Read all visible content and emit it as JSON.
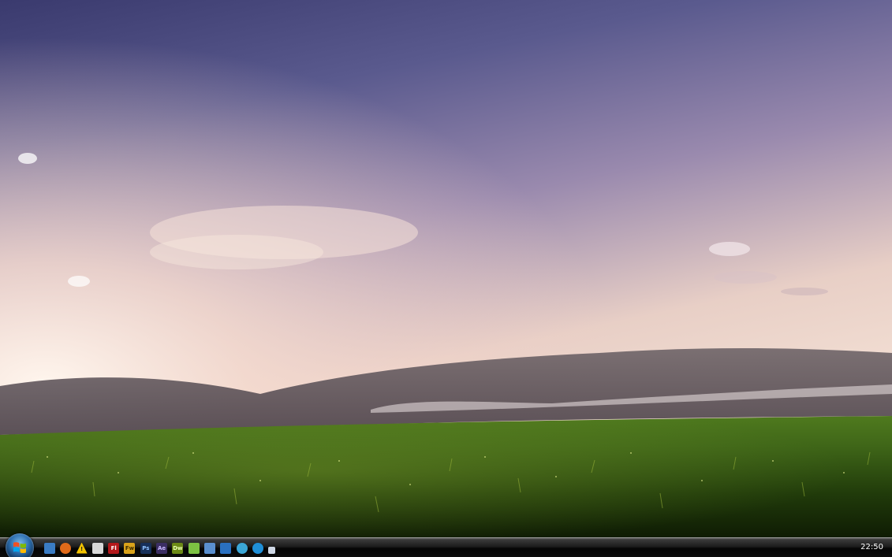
{
  "desktop": {
    "wallpaper": "grass-field-sunset"
  },
  "taskbar": {
    "start_button": "windows-start-orb",
    "quick_launch": [
      {
        "icon": "show-desktop-icon",
        "label": "",
        "bg": "#3a7cc4",
        "fg": "#ffffff"
      },
      {
        "icon": "firefox-icon",
        "label": "",
        "bg": "#e06a1a",
        "fg": "#ffffff"
      },
      {
        "icon": "warning-icon",
        "label": "!",
        "bg": "transparent",
        "fg": "#222222"
      },
      {
        "icon": "lock-icon",
        "label": "",
        "bg": "#d8d8d8",
        "fg": "#333333"
      },
      {
        "icon": "flash-icon",
        "label": "Fl",
        "bg": "#b3181b",
        "fg": "#ffffff"
      },
      {
        "icon": "fireworks-icon",
        "label": "Fw",
        "bg": "#d9a21a",
        "fg": "#3a2a00"
      },
      {
        "icon": "photoshop-icon",
        "label": "Ps",
        "bg": "#17305a",
        "fg": "#8fc2ff"
      },
      {
        "icon": "after-effects-icon",
        "label": "Ae",
        "bg": "#3b2e63",
        "fg": "#c7b7ff"
      },
      {
        "icon": "dreamweaver-icon",
        "label": "Dw",
        "bg": "#6c8a16",
        "fg": "#e9ffb0"
      },
      {
        "icon": "utorrent-icon",
        "label": "",
        "bg": "#7cc142",
        "fg": "#ffffff"
      },
      {
        "icon": "network-icon",
        "label": "",
        "bg": "#5a8fcf",
        "fg": "#ffffff"
      },
      {
        "icon": "remote-desktop-icon",
        "label": "",
        "bg": "#2a70c0",
        "fg": "#ffffff"
      },
      {
        "icon": "refresh-icon",
        "label": "",
        "bg": "#3ba6d6",
        "fg": "#ffffff"
      },
      {
        "icon": "messenger-icon",
        "label": "",
        "bg": "#1f8fd8",
        "fg": "#ffffff"
      },
      {
        "icon": "shortcut-icon",
        "label": "",
        "bg": "#cfd8e6",
        "fg": "#1f4f99"
      }
    ],
    "clock": "22:50"
  }
}
